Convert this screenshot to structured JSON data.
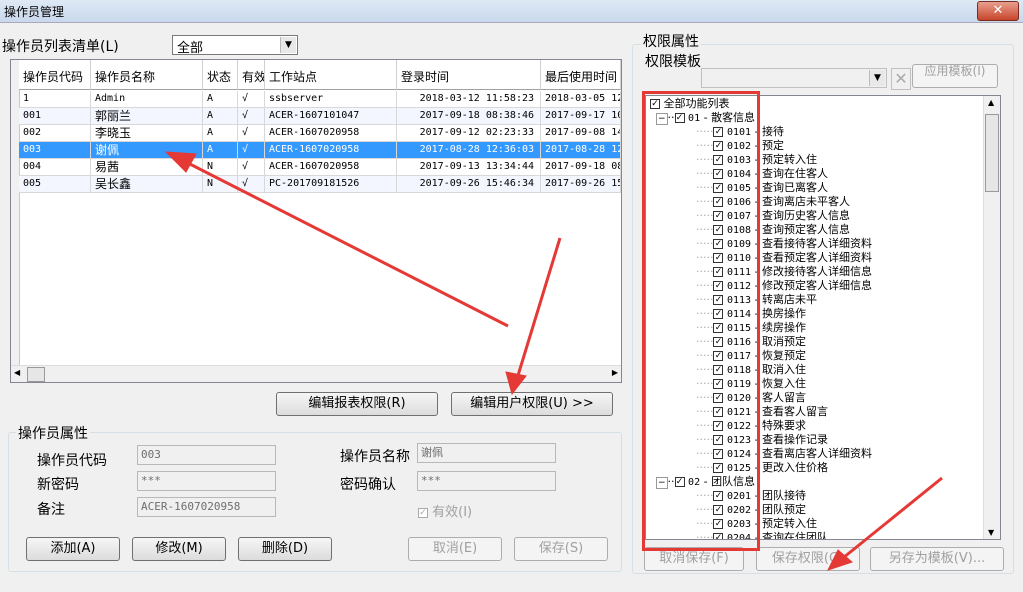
{
  "window": {
    "title": "操作员管理",
    "close": "✕"
  },
  "list": {
    "label": "操作员列表清单(L)",
    "filter": "全部",
    "columns": [
      "操作员代码",
      "操作员名称",
      "状态",
      "有效",
      "工作站点",
      "登录时间",
      "最后使用时间"
    ],
    "rows": [
      [
        "1",
        "Admin",
        "A",
        "√",
        "ssbserver",
        "2018-03-12 11:58:23",
        "2018-03-05 12"
      ],
      [
        "001",
        "郭丽兰",
        "A",
        "√",
        "ACER-1607101047",
        "2017-09-18 08:38:46",
        "2017-09-17 10"
      ],
      [
        "002",
        "李晓玉",
        "A",
        "√",
        "ACER-1607020958",
        "2017-09-12 02:23:33",
        "2017-09-08 14"
      ],
      [
        "003",
        "谢佩",
        "A",
        "√",
        "ACER-1607020958",
        "2017-08-28 12:36:03",
        "2017-08-28 12"
      ],
      [
        "004",
        "易茜",
        "N",
        "√",
        "ACER-1607020958",
        "2017-09-13 13:34:44",
        "2017-09-18 08"
      ],
      [
        "005",
        "吴长鑫",
        "N",
        "√",
        "PC-201709181526",
        "2017-09-26 15:46:34",
        "2017-09-26 15"
      ]
    ],
    "selected_row": 3
  },
  "buttons": {
    "edit_report": "编辑报表权限(R)",
    "edit_user": "编辑用户权限(U) >>",
    "add": "添加(A)",
    "modify": "修改(M)",
    "delete": "删除(D)",
    "cancel": "取消(E)",
    "save": "保存(S)",
    "apply_template": "应用模板(I)",
    "cancel_save": "取消保存(F)",
    "save_rights": "保存权限(G)",
    "save_as_template": "另存为模板(V)..."
  },
  "props": {
    "group_title": "操作员属性",
    "code_label": "操作员代码",
    "code_value": "003",
    "name_label": "操作员名称",
    "name_value": "谢佩",
    "pwd_label": "新密码",
    "pwd_value": "***",
    "pwd2_label": "密码确认",
    "pwd2_value": "***",
    "note_label": "备注",
    "note_value": "ACER-1607020958",
    "valid_label": "有效(I)"
  },
  "rights": {
    "group_title": "权限属性",
    "template_label": "权限模板",
    "root": "全部功能列表",
    "groups": [
      {
        "code": "01",
        "name": "散客信息",
        "items": [
          [
            "0101",
            "接待"
          ],
          [
            "0102",
            "预定"
          ],
          [
            "0103",
            "预定转入住"
          ],
          [
            "0104",
            "查询在住客人"
          ],
          [
            "0105",
            "查询已离客人"
          ],
          [
            "0106",
            "查询离店未平客人"
          ],
          [
            "0107",
            "查询历史客人信息"
          ],
          [
            "0108",
            "查询预定客人信息"
          ],
          [
            "0109",
            "查看接待客人详细资料"
          ],
          [
            "0110",
            "查看预定客人详细资料"
          ],
          [
            "0111",
            "修改接待客人详细信息"
          ],
          [
            "0112",
            "修改预定客人详细信息"
          ],
          [
            "0113",
            "转离店未平"
          ],
          [
            "0114",
            "换房操作"
          ],
          [
            "0115",
            "续房操作"
          ],
          [
            "0116",
            "取消预定"
          ],
          [
            "0117",
            "恢复预定"
          ],
          [
            "0118",
            "取消入住"
          ],
          [
            "0119",
            "恢复入住"
          ],
          [
            "0120",
            "客人留言"
          ],
          [
            "0121",
            "查看客人留言"
          ],
          [
            "0122",
            "特殊要求"
          ],
          [
            "0123",
            "查看操作记录"
          ],
          [
            "0124",
            "查看离店客人详细资料"
          ],
          [
            "0125",
            "更改入住价格"
          ]
        ]
      },
      {
        "code": "02",
        "name": "团队信息",
        "items": [
          [
            "0201",
            "团队接待"
          ],
          [
            "0202",
            "团队预定"
          ],
          [
            "0203",
            "预定转入住"
          ],
          [
            "0204",
            "查询在住团队"
          ]
        ]
      }
    ]
  },
  "colors": {
    "selection": "#3399ff",
    "annotation": "#e53935"
  }
}
